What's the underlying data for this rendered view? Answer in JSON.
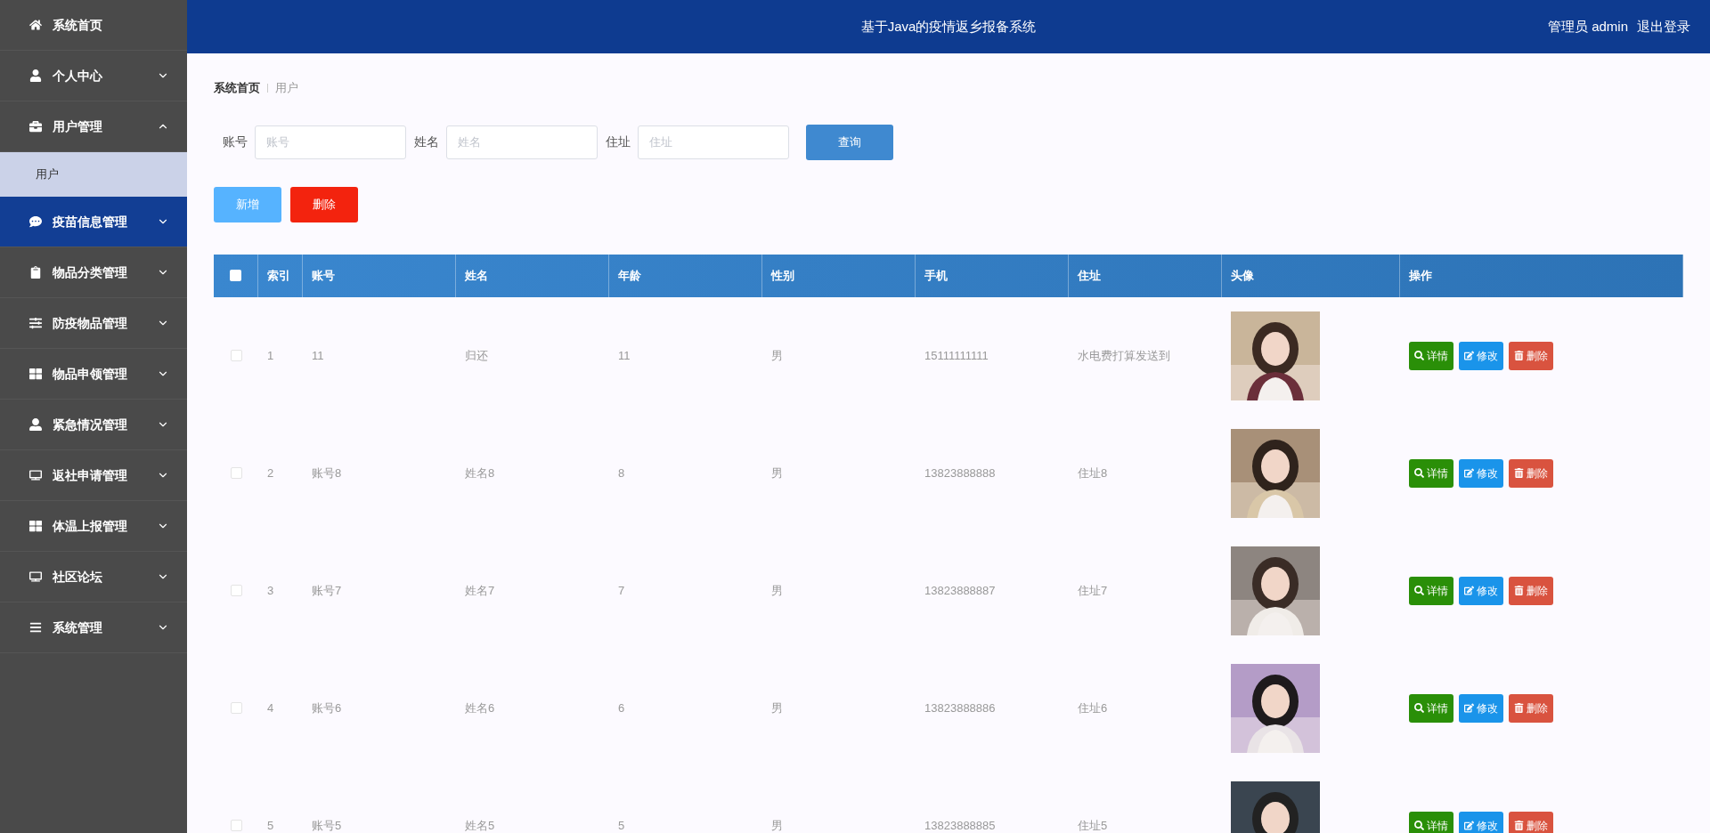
{
  "sidebar": {
    "items": [
      {
        "label": "系统首页",
        "kind": "link",
        "selected": false
      },
      {
        "label": "个人中心",
        "kind": "menu",
        "expanded": false,
        "selected": false
      },
      {
        "label": "用户管理",
        "kind": "menu",
        "expanded": true,
        "selected": false,
        "children": [
          {
            "label": "用户",
            "selected": true
          }
        ]
      },
      {
        "label": "疫苗信息管理",
        "kind": "menu",
        "expanded": false,
        "selected": true
      },
      {
        "label": "物品分类管理",
        "kind": "menu",
        "expanded": false,
        "selected": false
      },
      {
        "label": "防疫物品管理",
        "kind": "menu",
        "expanded": false,
        "selected": false
      },
      {
        "label": "物品申领管理",
        "kind": "menu",
        "expanded": false,
        "selected": false
      },
      {
        "label": "紧急情况管理",
        "kind": "menu",
        "expanded": false,
        "selected": false
      },
      {
        "label": "返社申请管理",
        "kind": "menu",
        "expanded": false,
        "selected": false
      },
      {
        "label": "体温上报管理",
        "kind": "menu",
        "expanded": false,
        "selected": false
      },
      {
        "label": "社区论坛",
        "kind": "menu",
        "expanded": false,
        "selected": false
      },
      {
        "label": "系统管理",
        "kind": "menu",
        "expanded": false,
        "selected": false
      }
    ]
  },
  "header": {
    "title": "基于Java的疫情返乡报备系统",
    "user": "管理员 admin",
    "logout": "退出登录"
  },
  "breadcrumb": [
    "系统首页",
    "用户"
  ],
  "search": {
    "fields": [
      {
        "label": "账号",
        "placeholder": "账号"
      },
      {
        "label": "姓名",
        "placeholder": "姓名"
      },
      {
        "label": "住址",
        "placeholder": "住址"
      }
    ],
    "button": "查询"
  },
  "actions": [
    {
      "label": "新增",
      "kind": "add"
    },
    {
      "label": "删除",
      "kind": "delete"
    }
  ],
  "table": {
    "all_checked": false,
    "columns": [
      "索引",
      "账号",
      "姓名",
      "年龄",
      "性别",
      "手机",
      "住址",
      "头像",
      "操作"
    ],
    "rows": [
      {
        "checked": false,
        "cells": [
          "1",
          "11",
          "归还",
          "11",
          "男",
          "15111111111",
          "水电费打算发送到"
        ],
        "actions": [
          {
            "label": "详情",
            "kind": "detail"
          },
          {
            "label": "修改",
            "kind": "edit"
          },
          {
            "label": "删除",
            "kind": "delete"
          }
        ]
      },
      {
        "checked": false,
        "cells": [
          "2",
          "账号8",
          "姓名8",
          "8",
          "男",
          "13823888888",
          "住址8"
        ],
        "actions": [
          {
            "label": "详情",
            "kind": "detail"
          },
          {
            "label": "修改",
            "kind": "edit"
          },
          {
            "label": "删除",
            "kind": "delete"
          }
        ]
      },
      {
        "checked": false,
        "cells": [
          "3",
          "账号7",
          "姓名7",
          "7",
          "男",
          "13823888887",
          "住址7"
        ],
        "actions": [
          {
            "label": "详情",
            "kind": "detail"
          },
          {
            "label": "修改",
            "kind": "edit"
          },
          {
            "label": "删除",
            "kind": "delete"
          }
        ]
      },
      {
        "checked": false,
        "cells": [
          "4",
          "账号6",
          "姓名6",
          "6",
          "男",
          "13823888886",
          "住址6"
        ],
        "actions": [
          {
            "label": "详情",
            "kind": "detail"
          },
          {
            "label": "修改",
            "kind": "edit"
          },
          {
            "label": "删除",
            "kind": "delete"
          }
        ]
      },
      {
        "checked": false,
        "cells": [
          "5",
          "账号5",
          "姓名5",
          "5",
          "男",
          "13823888885",
          "住址5"
        ],
        "actions": [
          {
            "label": "详情",
            "kind": "detail"
          },
          {
            "label": "修改",
            "kind": "edit"
          },
          {
            "label": "删除",
            "kind": "delete"
          }
        ]
      }
    ]
  }
}
